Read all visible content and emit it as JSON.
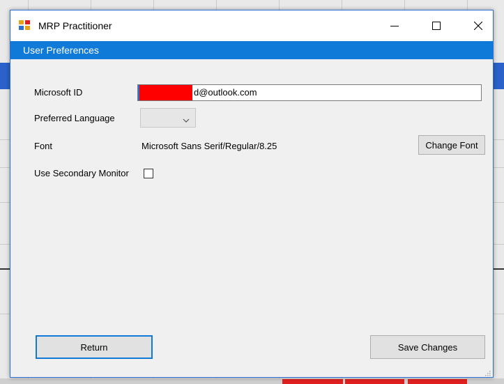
{
  "window": {
    "title": "MRP Practitioner",
    "banner": "User Preferences"
  },
  "form": {
    "microsoft_id_label": "Microsoft ID",
    "microsoft_id_value": "d@outlook.com",
    "preferred_language_label": "Preferred Language",
    "preferred_language_value": "",
    "font_label": "Font",
    "font_value": "Microsoft Sans Serif/Regular/8.25",
    "change_font_label": "Change Font",
    "secondary_monitor_label": "Use Secondary Monitor",
    "secondary_monitor_checked": false
  },
  "buttons": {
    "return_label": "Return",
    "save_label": "Save Changes"
  },
  "colors": {
    "banner": "#0f7ad7",
    "redaction": "#ff0000",
    "window_border": "#2b6fd6"
  },
  "icons": [
    "app-icon",
    "minimize-icon",
    "maximize-icon",
    "close-icon",
    "chevron-down-icon",
    "resize-grip-icon"
  ]
}
